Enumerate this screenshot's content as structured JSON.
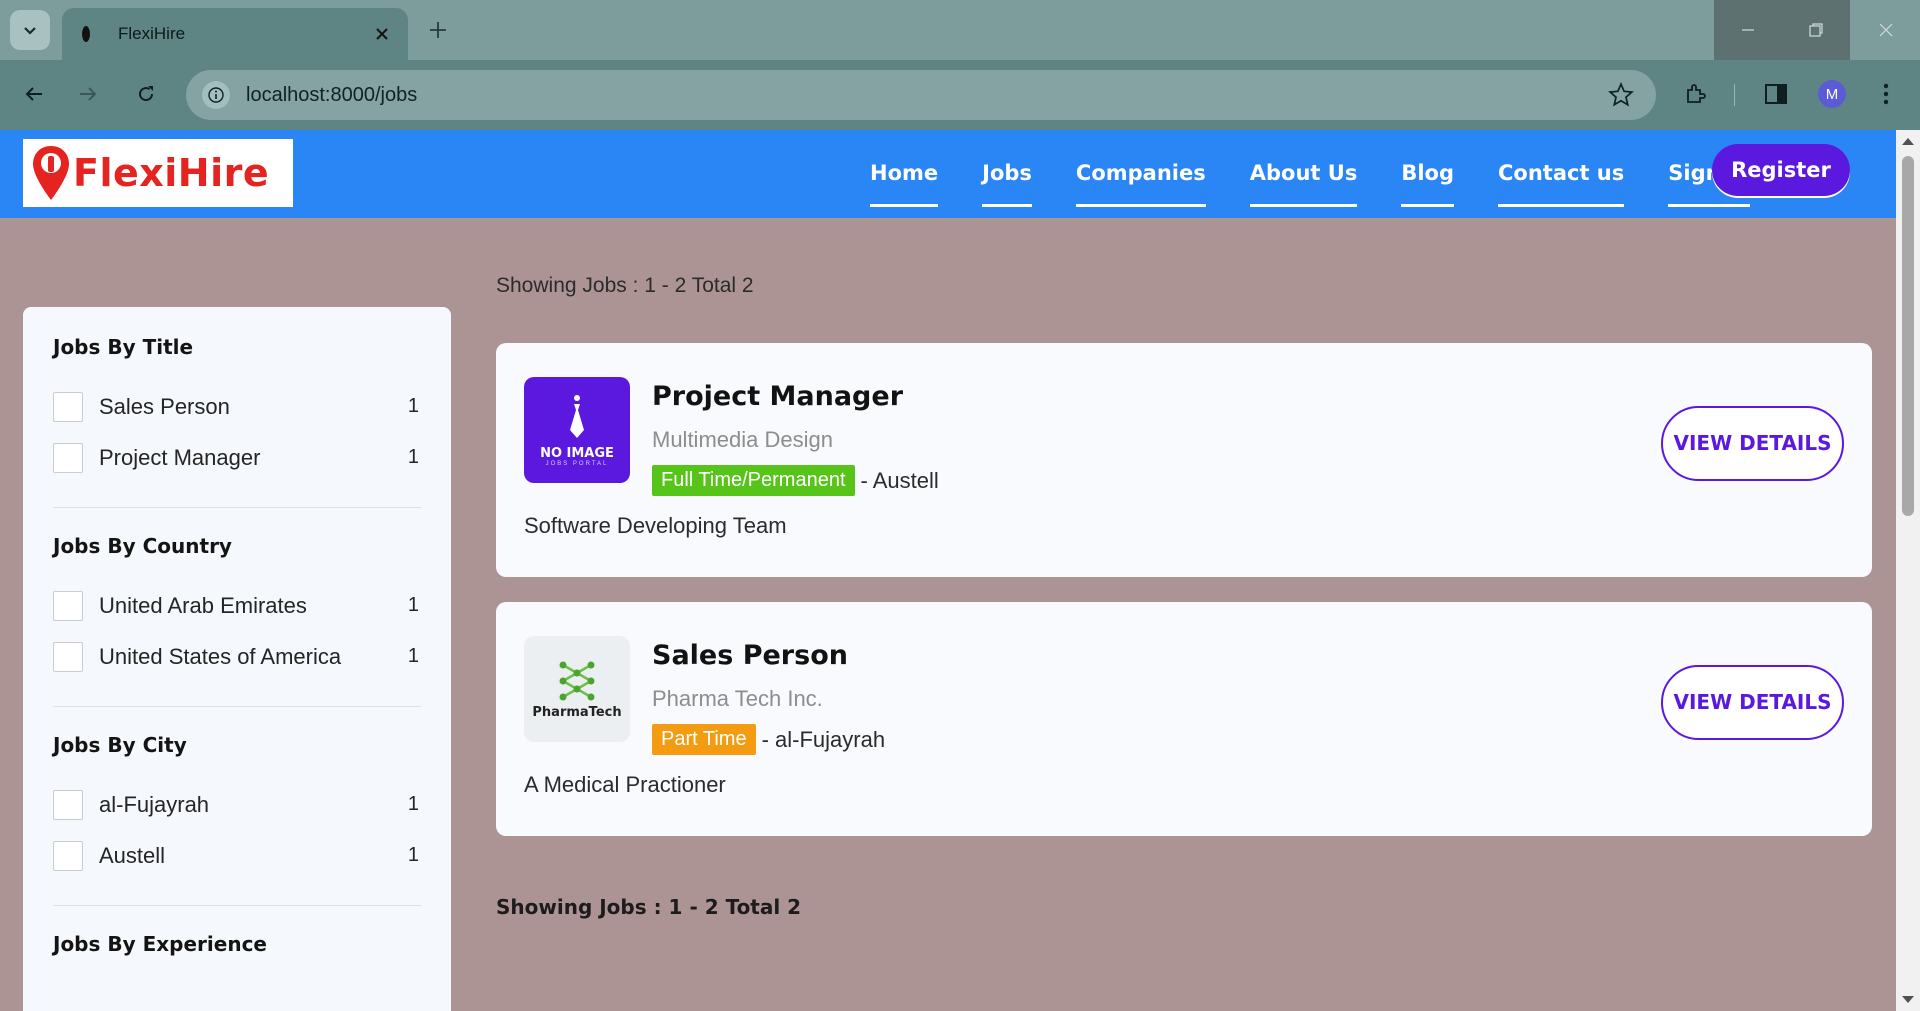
{
  "browser": {
    "tab_title": "FlexiHire",
    "url": "localhost:8000/jobs",
    "profile_initial": "M"
  },
  "site": {
    "logo_text": "FlexiHire",
    "nav": [
      {
        "label": "Home"
      },
      {
        "label": "Jobs"
      },
      {
        "label": "Companies"
      },
      {
        "label": "About Us"
      },
      {
        "label": "Blog"
      },
      {
        "label": "Contact us"
      },
      {
        "label": "Sign in"
      }
    ],
    "register_label": "Register"
  },
  "filters": [
    {
      "title": "Jobs By Title",
      "items": [
        {
          "label": "Sales Person",
          "count": "1"
        },
        {
          "label": "Project Manager",
          "count": "1"
        }
      ]
    },
    {
      "title": "Jobs By Country",
      "items": [
        {
          "label": "United Arab Emirates",
          "count": "1"
        },
        {
          "label": "United States of America",
          "count": "1"
        }
      ]
    },
    {
      "title": "Jobs By City",
      "items": [
        {
          "label": "al-Fujayrah",
          "count": "1"
        },
        {
          "label": "Austell",
          "count": "1"
        }
      ]
    },
    {
      "title": "Jobs By Experience",
      "items": []
    }
  ],
  "listing": {
    "showing_top": "Showing Jobs : 1 - 2 Total 2",
    "showing_bottom": "Showing Jobs : 1 - 2 Total 2",
    "jobs": [
      {
        "title": "Project Manager",
        "company": "Multimedia Design",
        "type": "Full Time/Permanent",
        "location": "- Austell",
        "description": "Software Developing Team",
        "logo_text": "NO IMAGE",
        "logo_subtext": "JOBS PORTAL",
        "view_label": "VIEW DETAILS"
      },
      {
        "title": "Sales Person",
        "company": "Pharma Tech Inc.",
        "type": "Part Time",
        "location": "- al-Fujayrah",
        "description": "A Medical Practioner",
        "logo_text": "PharmaTech",
        "view_label": "VIEW DETAILS"
      }
    ]
  },
  "colors": {
    "header_blue": "#2a86f5",
    "accent_purple": "#5b19e0",
    "fulltime_green": "#57c41a",
    "parttime_orange": "#f39c12",
    "page_bg": "#ad9494",
    "logo_red": "#e52421"
  },
  "icons": [
    "tab-list-icon",
    "tab-favicon-icon",
    "close-icon",
    "plus-icon",
    "minimize-icon",
    "restore-icon",
    "back-arrow-icon",
    "forward-arrow-icon",
    "reload-icon",
    "info-icon",
    "star-icon",
    "extensions-icon",
    "side-panel-icon",
    "kebab-menu-icon",
    "location-pin-icon",
    "tie-icon",
    "molecule-icon"
  ]
}
